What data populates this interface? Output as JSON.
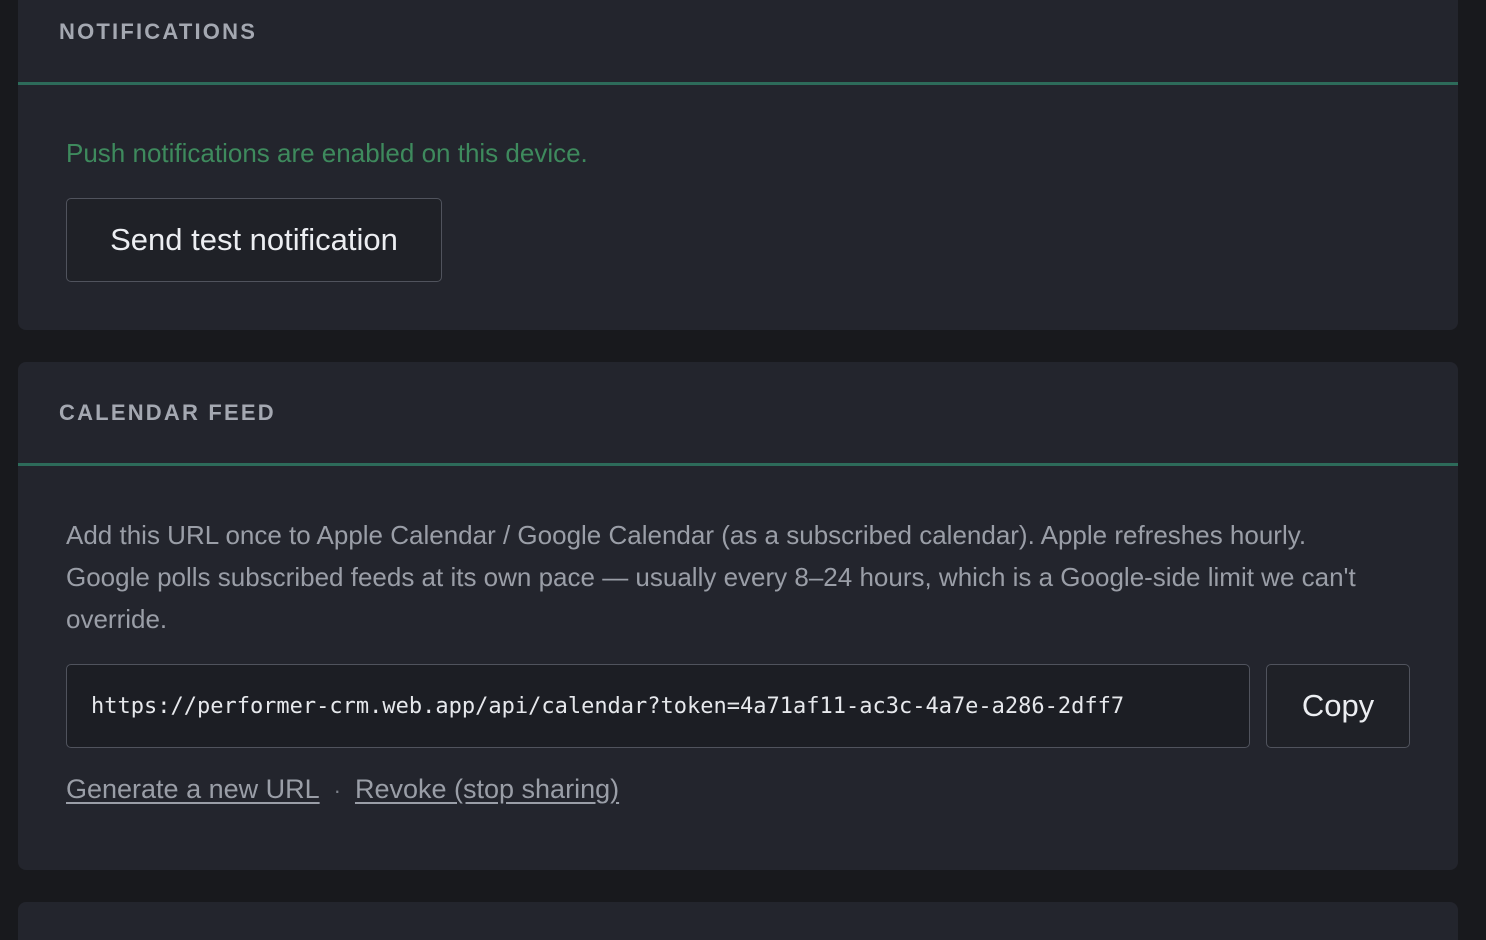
{
  "notifications": {
    "title": "NOTIFICATIONS",
    "status_text": "Push notifications are enabled on this device.",
    "status_color": "#3e8a5d",
    "test_button_label": "Send test notification"
  },
  "calendar": {
    "title": "CALENDAR FEED",
    "description": "Add this URL once to Apple Calendar / Google Calendar (as a subscribed calendar). Apple refreshes hourly. Google polls subscribed feeds at its own pace — usually every 8–24 hours, which is a Google-side limit we can't override.",
    "feed_url": "https://performer-crm.web.app/api/calendar?token=4a71af11-ac3c-4a7e-a286-2dff7",
    "copy_label": "Copy",
    "regenerate_label": "Generate a new URL",
    "separator": "·",
    "revoke_label": "Revoke (stop sharing)"
  },
  "colors": {
    "accent_rule": "#2d6b5a",
    "card_bg": "#23252d",
    "page_bg": "#18191d"
  }
}
